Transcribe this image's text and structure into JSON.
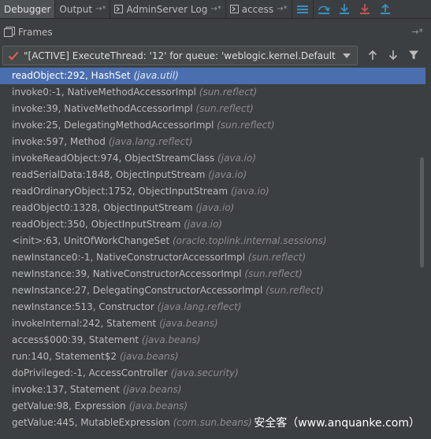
{
  "tabs": [
    {
      "label": "Debugger"
    },
    {
      "label": "Output",
      "pin": "→*"
    },
    {
      "label": "AdminServer Log",
      "pin": "→*"
    },
    {
      "label": "access",
      "pin": "→*"
    }
  ],
  "toolbar": {
    "icons": [
      "menu-icon",
      "step-over-icon",
      "step-into-icon",
      "force-step-into-icon",
      "step-out-icon"
    ]
  },
  "frames_panel": {
    "title": "Frames",
    "restore_label": "→*"
  },
  "thread_selector": {
    "value": "\"[ACTIVE] ExecuteThread: '12' for queue: 'weblogic.kernel.Default (s..."
  },
  "frames": [
    {
      "method": "readObject:292, HashSet",
      "pkg": "(java.util)",
      "selected": true
    },
    {
      "method": "invoke0:-1, NativeMethodAccessorImpl",
      "pkg": "(sun.reflect)"
    },
    {
      "method": "invoke:39, NativeMethodAccessorImpl",
      "pkg": "(sun.reflect)"
    },
    {
      "method": "invoke:25, DelegatingMethodAccessorImpl",
      "pkg": "(sun.reflect)"
    },
    {
      "method": "invoke:597, Method",
      "pkg": "(java.lang.reflect)"
    },
    {
      "method": "invokeReadObject:974, ObjectStreamClass",
      "pkg": "(java.io)"
    },
    {
      "method": "readSerialData:1848, ObjectInputStream",
      "pkg": "(java.io)"
    },
    {
      "method": "readOrdinaryObject:1752, ObjectInputStream",
      "pkg": "(java.io)"
    },
    {
      "method": "readObject0:1328, ObjectInputStream",
      "pkg": "(java.io)"
    },
    {
      "method": "readObject:350, ObjectInputStream",
      "pkg": "(java.io)"
    },
    {
      "method": "<init>:63, UnitOfWorkChangeSet",
      "pkg": "(oracle.toplink.internal.sessions)"
    },
    {
      "method": "newInstance0:-1, NativeConstructorAccessorImpl",
      "pkg": "(sun.reflect)"
    },
    {
      "method": "newInstance:39, NativeConstructorAccessorImpl",
      "pkg": "(sun.reflect)"
    },
    {
      "method": "newInstance:27, DelegatingConstructorAccessorImpl",
      "pkg": "(sun.reflect)"
    },
    {
      "method": "newInstance:513, Constructor",
      "pkg": "(java.lang.reflect)"
    },
    {
      "method": "invokeInternal:242, Statement",
      "pkg": "(java.beans)"
    },
    {
      "method": "access$000:39, Statement",
      "pkg": "(java.beans)"
    },
    {
      "method": "run:140, Statement$2",
      "pkg": "(java.beans)"
    },
    {
      "method": "doPrivileged:-1, AccessController",
      "pkg": "(java.security)"
    },
    {
      "method": "invoke:137, Statement",
      "pkg": "(java.beans)"
    },
    {
      "method": "getValue:98, Expression",
      "pkg": "(java.beans)"
    },
    {
      "method": "getValue:445, MutableExpression",
      "pkg": "(com.sun.beans)"
    }
  ],
  "watermark": "安全客（www.anquanke.com）",
  "colors": {
    "background": "#3c3f41",
    "selection": "#4b6eaf",
    "step_into_red": "#c75450",
    "step_blue": "#3592c4",
    "check_red": "#e05d4f"
  }
}
